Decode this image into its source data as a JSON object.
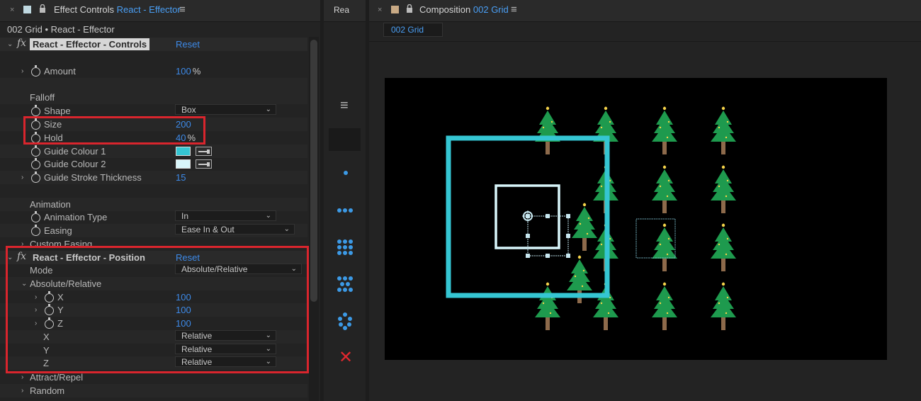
{
  "effect_controls": {
    "tab_title": "Effect Controls",
    "tab_layer": "React - Effector",
    "close_glyph": "×",
    "menu_glyph": "≡",
    "breadcrumb": "002 Grid • React - Effector",
    "controls_effect": {
      "name": "React - Effector - Controls",
      "reset": "Reset"
    },
    "amount": {
      "label": "Amount",
      "value": "100",
      "unit": "%"
    },
    "falloff": {
      "label": "Falloff",
      "shape": {
        "label": "Shape",
        "value": "Box"
      },
      "size": {
        "label": "Size",
        "value": "200"
      },
      "hold": {
        "label": "Hold",
        "value": "40",
        "unit": "%"
      },
      "guide_colour_1": {
        "label": "Guide Colour 1",
        "color": "#35c6d3"
      },
      "guide_colour_2": {
        "label": "Guide Colour 2",
        "color": "#d8f6fb"
      },
      "guide_stroke": {
        "label": "Guide Stroke Thickness",
        "value": "15"
      }
    },
    "animation": {
      "label": "Animation",
      "type": {
        "label": "Animation Type",
        "value": "In"
      },
      "easing": {
        "label": "Easing",
        "value": "Ease In & Out"
      },
      "custom_easing": {
        "label": "Custom Easing"
      }
    },
    "position_effect": {
      "name": "React - Effector - Position",
      "reset": "Reset",
      "mode": {
        "label": "Mode",
        "value": "Absolute/Relative"
      },
      "group": "Absolute/Relative",
      "x": {
        "label": "X",
        "value": "100"
      },
      "y": {
        "label": "Y",
        "value": "100"
      },
      "z": {
        "label": "Z",
        "value": "100"
      },
      "x_mode": {
        "label": "X",
        "value": "Relative"
      },
      "y_mode": {
        "label": "Y",
        "value": "Relative"
      },
      "z_mode": {
        "label": "Z",
        "value": "Relative"
      }
    },
    "attract_repel": {
      "label": "Attract/Repel"
    },
    "random": {
      "label": "Random"
    }
  },
  "middle_panel": {
    "tab_title": "Rea"
  },
  "composition": {
    "tab_title": "Composition",
    "tab_comp": "002 Grid",
    "close_glyph": "×",
    "menu_glyph": "≡",
    "viewer_tab": "002 Grid"
  },
  "colors": {
    "accent_blue": "#3d8ae8",
    "highlight_red": "#d9252d",
    "guide_cyan": "#35c6d3",
    "tree_green": "#1e9a4e",
    "icon_blue": "#3c9ae6",
    "close_red": "#e0282e"
  }
}
